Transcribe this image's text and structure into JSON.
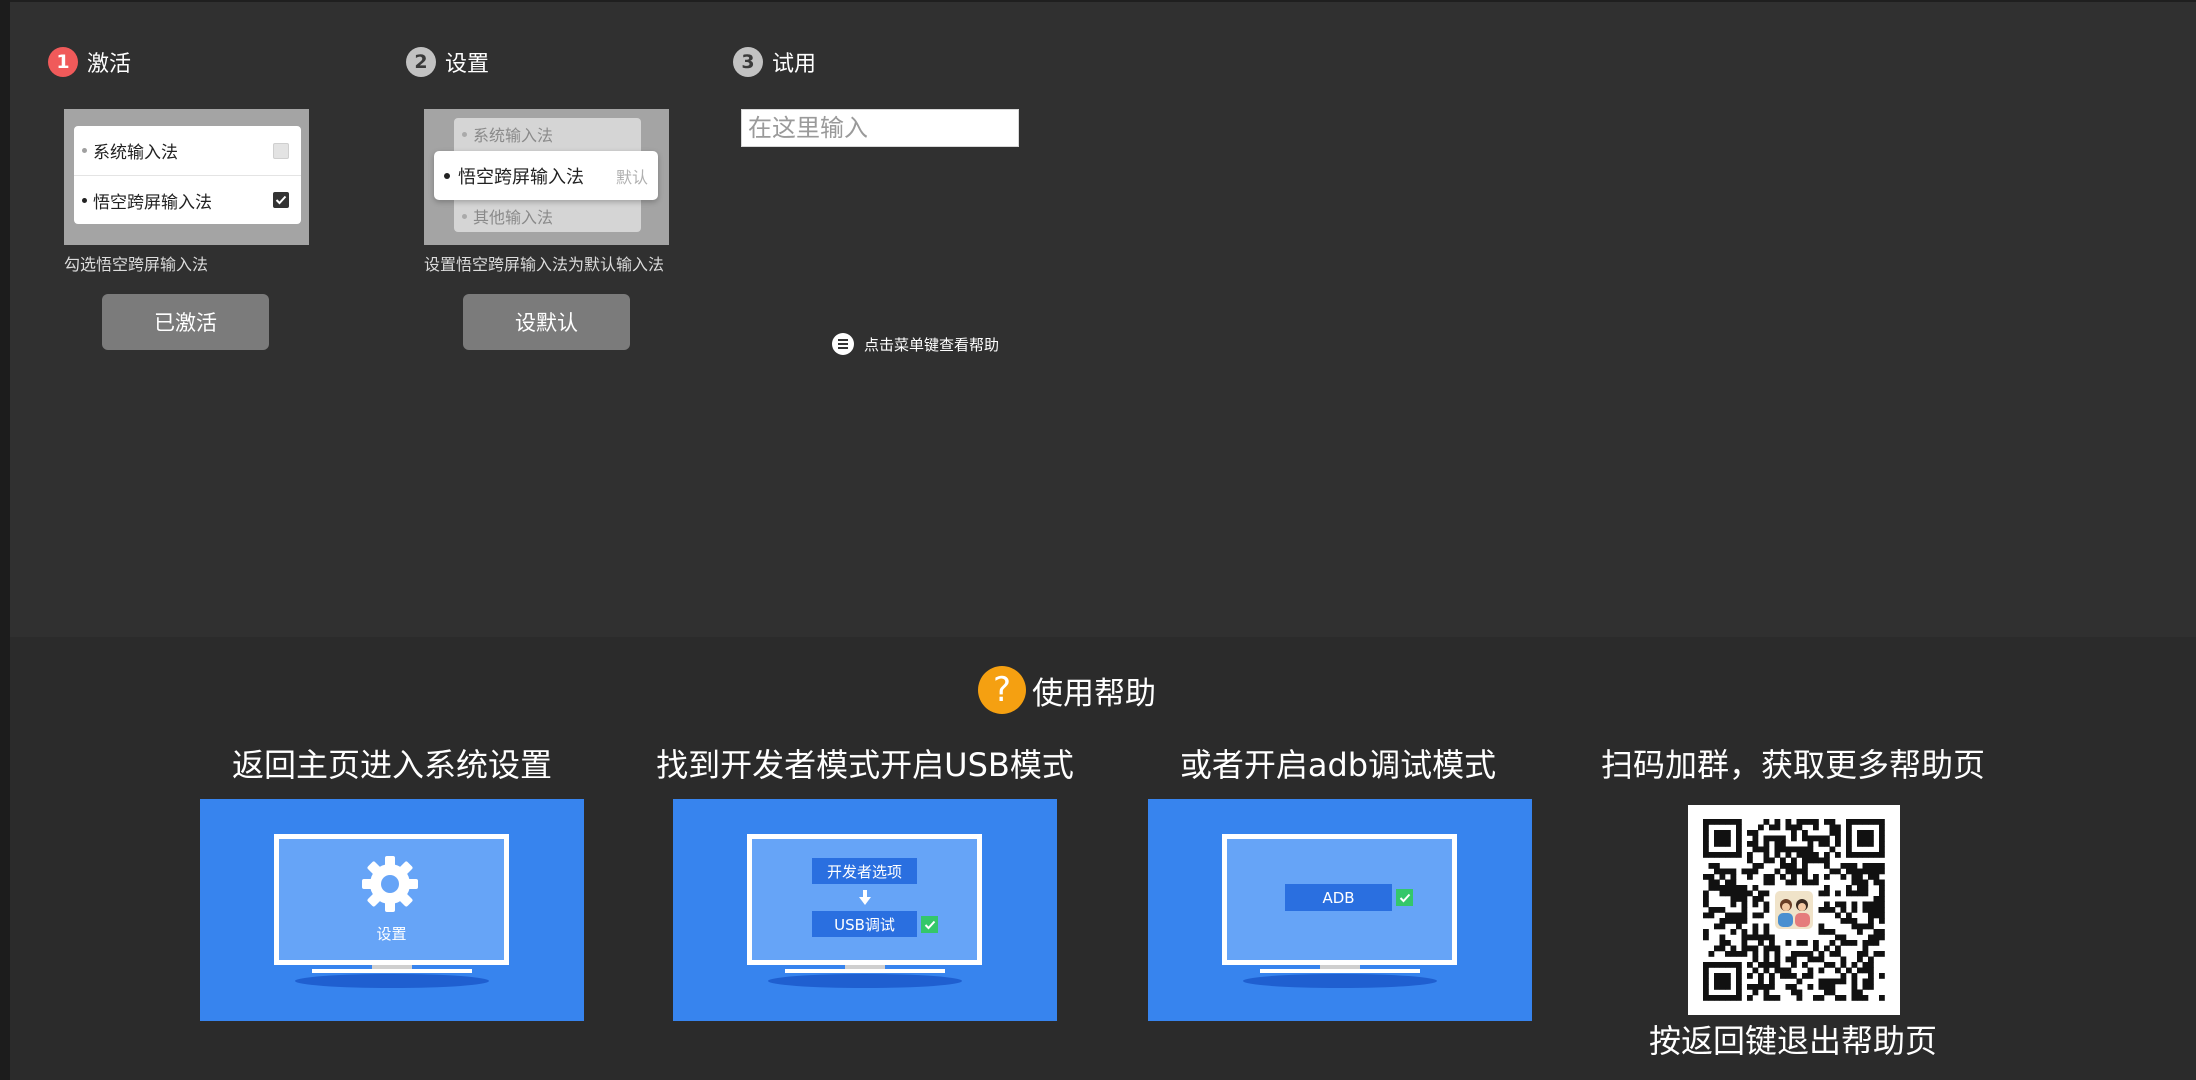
{
  "colors": {
    "step_active": "#f05a5a",
    "help_orange": "#f5a011",
    "panel_blue": "#3784ee",
    "check_green": "#34c76a"
  },
  "steps": [
    {
      "number": "1",
      "title": "激活",
      "caption": "勾选悟空跨屏输入法",
      "button": "已激活",
      "active": true
    },
    {
      "number": "2",
      "title": "设置",
      "caption": "设置悟空跨屏输入法为默认输入法",
      "button": "设默认",
      "active": false
    },
    {
      "number": "3",
      "title": "试用",
      "input_placeholder": "在这里输入",
      "active": false
    }
  ],
  "activate_preview": {
    "rows": [
      {
        "label": "系统输入法",
        "checked": false
      },
      {
        "label": "悟空跨屏输入法",
        "checked": true
      }
    ]
  },
  "default_preview": {
    "back_top": "系统输入法",
    "front": "悟空跨屏输入法",
    "front_tag": "默认",
    "back_bottom": "其他输入法"
  },
  "menu_hint": {
    "icon": "menu-icon",
    "text": "点击菜单键查看帮助"
  },
  "help": {
    "icon": "question-icon",
    "title": "使用帮助",
    "question_mark": "?",
    "columns": [
      {
        "title": "返回主页进入系统设置",
        "icon": "gear-icon",
        "screen_label": "设置"
      },
      {
        "title": "找到开发者模式开启USB模式",
        "screen_labels": [
          "开发者选项",
          "USB调试"
        ]
      },
      {
        "title": "或者开启adb调试模式",
        "screen_label": "ADB"
      },
      {
        "title": "扫码加群，获取更多帮助页",
        "icon": "qr-code",
        "footer": "按返回键退出帮助页"
      }
    ]
  }
}
